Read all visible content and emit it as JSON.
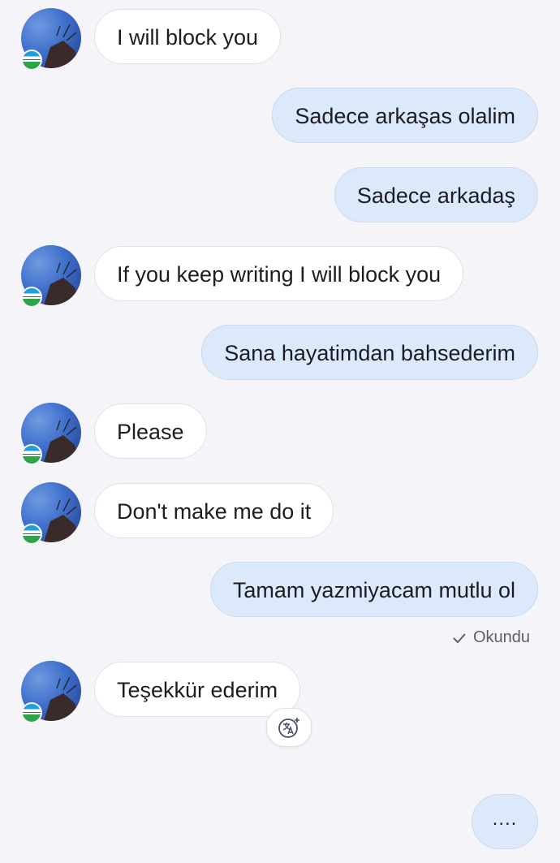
{
  "messages": [
    {
      "dir": "in",
      "text": "I will block you"
    },
    {
      "dir": "out",
      "text": "Sadece arkaşas olalim"
    },
    {
      "dir": "out",
      "text": "Sadece arkadaş"
    },
    {
      "dir": "in",
      "text": "If you keep writing I will block you"
    },
    {
      "dir": "out",
      "text": "Sana hayatimdan bahsederim"
    },
    {
      "dir": "in",
      "text": "Please"
    },
    {
      "dir": "in",
      "text": "Don't make me do it"
    },
    {
      "dir": "out",
      "text": "Tamam yazmiyacam mutlu ol"
    },
    {
      "dir": "in",
      "text": "Teşekkür ederim"
    }
  ],
  "read_status": "Okundu",
  "typing_text": "....",
  "icons": {
    "avatar": "avatar-photo",
    "flag": "flag-icon",
    "read": "checkmark-icon",
    "translate": "translate-icon"
  },
  "colors": {
    "background": "#f4f4f9",
    "incoming": "#ffffff",
    "outgoing": "#dce9fb"
  }
}
